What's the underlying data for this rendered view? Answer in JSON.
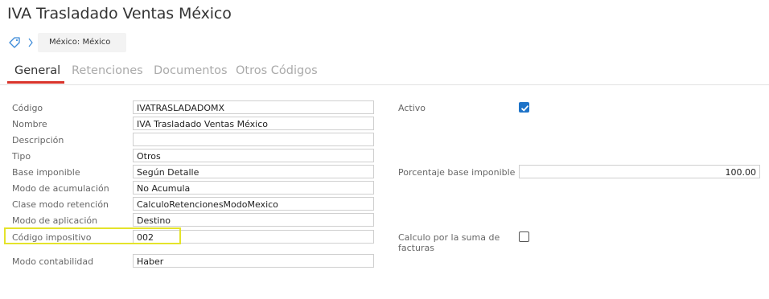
{
  "page": {
    "title": "IVA Trasladado Ventas México"
  },
  "breadcrumb": {
    "item": "México: México"
  },
  "tabs": [
    {
      "label": "General",
      "active": true
    },
    {
      "label": "Retenciones",
      "active": false
    },
    {
      "label": "Documentos",
      "active": false
    },
    {
      "label": "Otros Códigos",
      "active": false
    }
  ],
  "form": {
    "codigo": {
      "label": "Código",
      "value": "IVATRASLADADOMX"
    },
    "nombre": {
      "label": "Nombre",
      "value": "IVA Trasladado Ventas México"
    },
    "descripcion": {
      "label": "Descripción",
      "value": ""
    },
    "tipo": {
      "label": "Tipo",
      "value": "Otros"
    },
    "base_imponible": {
      "label": "Base imponible",
      "value": "Según Detalle"
    },
    "modo_acumulacion": {
      "label": "Modo de acumulación",
      "value": "No Acumula"
    },
    "clase_modo_retencion": {
      "label": "Clase modo retención",
      "value": "CalculoRetencionesModoMexico"
    },
    "modo_aplicacion": {
      "label": "Modo de aplicación",
      "value": "Destino"
    },
    "codigo_impositivo": {
      "label": "Código impositivo",
      "value": "002"
    },
    "modo_contabilidad": {
      "label": "Modo contabilidad",
      "value": "Haber"
    },
    "activo": {
      "label": "Activo",
      "checked": true
    },
    "porcentaje_base": {
      "label": "Porcentaje base imponible",
      "value": "100.00"
    },
    "calculo_suma": {
      "label_line1": "Calculo por la suma de",
      "label_line2": "facturas",
      "checked": false
    }
  },
  "colors": {
    "accent": "#d9342b",
    "checkbox": "#1e73c8",
    "highlight": "#e4e32b"
  },
  "icons": {
    "breadcrumb_tag": "tag-icon",
    "breadcrumb_sep": "chevron-right-icon",
    "check": "check-icon"
  }
}
